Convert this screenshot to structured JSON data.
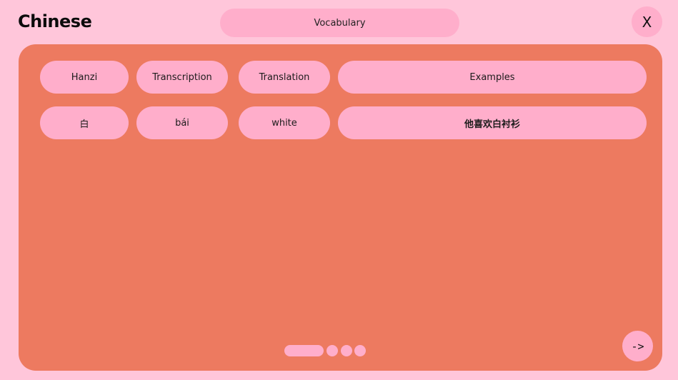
{
  "header": {
    "app_title": "Chinese",
    "section_label": "Vocabulary",
    "close_label": "X"
  },
  "table": {
    "headers": [
      "Hanzi",
      "Transcription",
      "Translation",
      "Examples"
    ],
    "rows": [
      [
        "白",
        "bái",
        "white",
        "他喜欢白衬衫"
      ]
    ]
  },
  "pagination": {
    "total_pages": 4,
    "current_page": 1
  },
  "navigation": {
    "next_label": "->"
  },
  "colors": {
    "background": "#ffc6da",
    "panel": "#ed7a60",
    "pill": "#ffaecb"
  }
}
